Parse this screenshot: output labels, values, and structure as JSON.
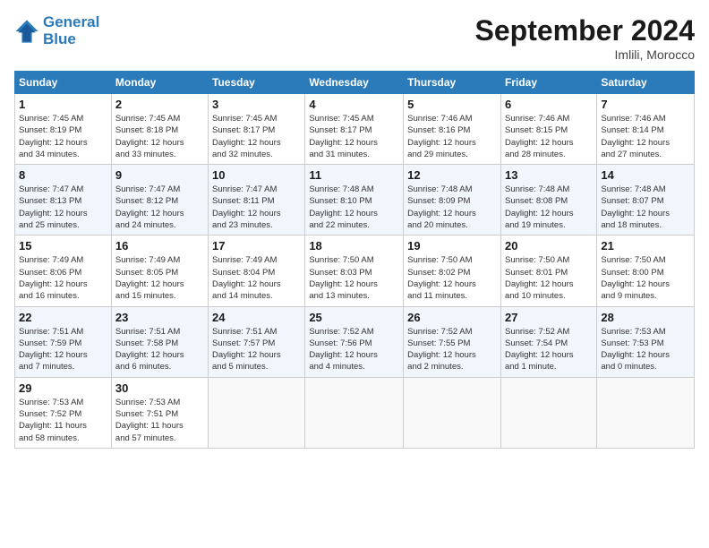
{
  "header": {
    "logo_line1": "General",
    "logo_line2": "Blue",
    "month_title": "September 2024",
    "location": "Imlili, Morocco"
  },
  "days_of_week": [
    "Sunday",
    "Monday",
    "Tuesday",
    "Wednesday",
    "Thursday",
    "Friday",
    "Saturday"
  ],
  "weeks": [
    [
      {
        "day": "1",
        "info": "Sunrise: 7:45 AM\nSunset: 8:19 PM\nDaylight: 12 hours\nand 34 minutes."
      },
      {
        "day": "2",
        "info": "Sunrise: 7:45 AM\nSunset: 8:18 PM\nDaylight: 12 hours\nand 33 minutes."
      },
      {
        "day": "3",
        "info": "Sunrise: 7:45 AM\nSunset: 8:17 PM\nDaylight: 12 hours\nand 32 minutes."
      },
      {
        "day": "4",
        "info": "Sunrise: 7:45 AM\nSunset: 8:17 PM\nDaylight: 12 hours\nand 31 minutes."
      },
      {
        "day": "5",
        "info": "Sunrise: 7:46 AM\nSunset: 8:16 PM\nDaylight: 12 hours\nand 29 minutes."
      },
      {
        "day": "6",
        "info": "Sunrise: 7:46 AM\nSunset: 8:15 PM\nDaylight: 12 hours\nand 28 minutes."
      },
      {
        "day": "7",
        "info": "Sunrise: 7:46 AM\nSunset: 8:14 PM\nDaylight: 12 hours\nand 27 minutes."
      }
    ],
    [
      {
        "day": "8",
        "info": "Sunrise: 7:47 AM\nSunset: 8:13 PM\nDaylight: 12 hours\nand 25 minutes."
      },
      {
        "day": "9",
        "info": "Sunrise: 7:47 AM\nSunset: 8:12 PM\nDaylight: 12 hours\nand 24 minutes."
      },
      {
        "day": "10",
        "info": "Sunrise: 7:47 AM\nSunset: 8:11 PM\nDaylight: 12 hours\nand 23 minutes."
      },
      {
        "day": "11",
        "info": "Sunrise: 7:48 AM\nSunset: 8:10 PM\nDaylight: 12 hours\nand 22 minutes."
      },
      {
        "day": "12",
        "info": "Sunrise: 7:48 AM\nSunset: 8:09 PM\nDaylight: 12 hours\nand 20 minutes."
      },
      {
        "day": "13",
        "info": "Sunrise: 7:48 AM\nSunset: 8:08 PM\nDaylight: 12 hours\nand 19 minutes."
      },
      {
        "day": "14",
        "info": "Sunrise: 7:48 AM\nSunset: 8:07 PM\nDaylight: 12 hours\nand 18 minutes."
      }
    ],
    [
      {
        "day": "15",
        "info": "Sunrise: 7:49 AM\nSunset: 8:06 PM\nDaylight: 12 hours\nand 16 minutes."
      },
      {
        "day": "16",
        "info": "Sunrise: 7:49 AM\nSunset: 8:05 PM\nDaylight: 12 hours\nand 15 minutes."
      },
      {
        "day": "17",
        "info": "Sunrise: 7:49 AM\nSunset: 8:04 PM\nDaylight: 12 hours\nand 14 minutes."
      },
      {
        "day": "18",
        "info": "Sunrise: 7:50 AM\nSunset: 8:03 PM\nDaylight: 12 hours\nand 13 minutes."
      },
      {
        "day": "19",
        "info": "Sunrise: 7:50 AM\nSunset: 8:02 PM\nDaylight: 12 hours\nand 11 minutes."
      },
      {
        "day": "20",
        "info": "Sunrise: 7:50 AM\nSunset: 8:01 PM\nDaylight: 12 hours\nand 10 minutes."
      },
      {
        "day": "21",
        "info": "Sunrise: 7:50 AM\nSunset: 8:00 PM\nDaylight: 12 hours\nand 9 minutes."
      }
    ],
    [
      {
        "day": "22",
        "info": "Sunrise: 7:51 AM\nSunset: 7:59 PM\nDaylight: 12 hours\nand 7 minutes."
      },
      {
        "day": "23",
        "info": "Sunrise: 7:51 AM\nSunset: 7:58 PM\nDaylight: 12 hours\nand 6 minutes."
      },
      {
        "day": "24",
        "info": "Sunrise: 7:51 AM\nSunset: 7:57 PM\nDaylight: 12 hours\nand 5 minutes."
      },
      {
        "day": "25",
        "info": "Sunrise: 7:52 AM\nSunset: 7:56 PM\nDaylight: 12 hours\nand 4 minutes."
      },
      {
        "day": "26",
        "info": "Sunrise: 7:52 AM\nSunset: 7:55 PM\nDaylight: 12 hours\nand 2 minutes."
      },
      {
        "day": "27",
        "info": "Sunrise: 7:52 AM\nSunset: 7:54 PM\nDaylight: 12 hours\nand 1 minute."
      },
      {
        "day": "28",
        "info": "Sunrise: 7:53 AM\nSunset: 7:53 PM\nDaylight: 12 hours\nand 0 minutes."
      }
    ],
    [
      {
        "day": "29",
        "info": "Sunrise: 7:53 AM\nSunset: 7:52 PM\nDaylight: 11 hours\nand 58 minutes."
      },
      {
        "day": "30",
        "info": "Sunrise: 7:53 AM\nSunset: 7:51 PM\nDaylight: 11 hours\nand 57 minutes."
      },
      {
        "day": "",
        "info": ""
      },
      {
        "day": "",
        "info": ""
      },
      {
        "day": "",
        "info": ""
      },
      {
        "day": "",
        "info": ""
      },
      {
        "day": "",
        "info": ""
      }
    ]
  ]
}
